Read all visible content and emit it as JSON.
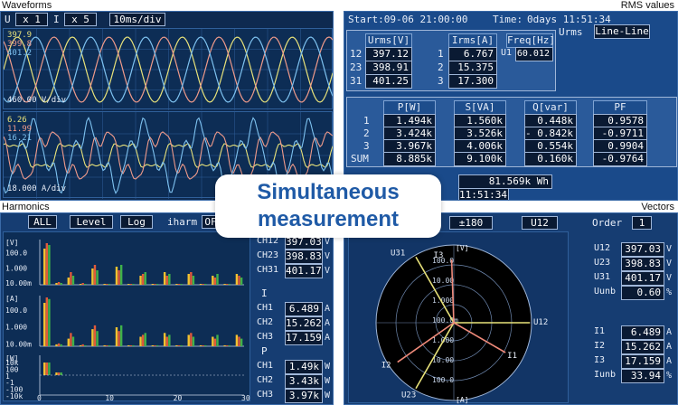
{
  "labels": {
    "waveforms": "Waveforms",
    "rms": "RMS values",
    "harmonics": "Harmonics",
    "vectors": "Vectors"
  },
  "waveforms": {
    "u_label": "U",
    "u_val": "x 1",
    "i_label": "I",
    "i_val": "x 5",
    "timebase": "10ms/div",
    "v_readings": [
      "397.9",
      "399.8",
      "401.2"
    ],
    "v_scale": "460.00 V/div",
    "a_readings": [
      "6.26",
      "11.99",
      "16.21"
    ],
    "a_scale": "18.000 A/div",
    "colors": {
      "u12": "#e8e27a",
      "u23": "#ef9a8a",
      "u31": "#7ec2f0"
    }
  },
  "rms": {
    "start": "Start:09-06 21:00:00",
    "time_label": "Time:",
    "time_val": "0days 11:51:34",
    "mode_label": "Urms",
    "mode_val": "Line-Line",
    "urms_hdr": "Urms[V]",
    "irms_hdr": "Irms[A]",
    "freq_hdr": "Freq[Hz]",
    "u_rows": [
      {
        "n": "12",
        "v": "397.12"
      },
      {
        "n": "23",
        "v": "398.91"
      },
      {
        "n": "31",
        "v": "401.25"
      }
    ],
    "i_rows": [
      {
        "n": "1",
        "v": "6.767"
      },
      {
        "n": "2",
        "v": "15.375"
      },
      {
        "n": "3",
        "v": "17.300"
      }
    ],
    "freq_row": {
      "n": "U1",
      "v": "60.012"
    },
    "p_hdr": "P[W]",
    "s_hdr": "S[VA]",
    "q_hdr": "Q[var]",
    "pf_hdr": "PF",
    "power_rows": [
      {
        "n": "1",
        "p": "1.494k",
        "s": "1.560k",
        "q": "0.448k",
        "pf": "0.9578"
      },
      {
        "n": "2",
        "p": "3.424k",
        "s": "3.526k",
        "q": "- 0.842k",
        "pf": "-0.9711"
      },
      {
        "n": "3",
        "p": "3.967k",
        "s": "4.006k",
        "q": "0.554k",
        "pf": "0.9904"
      },
      {
        "n": "SUM",
        "p": "8.885k",
        "s": "9.100k",
        "q": "0.160k",
        "pf": "-0.9764"
      }
    ],
    "energy_val": "81.569k",
    "energy_unit": "Wh",
    "elapsed": "11:51:34"
  },
  "harmonics": {
    "btn_all": "ALL",
    "btn_level": "Level",
    "btn_log": "Log",
    "mode_label": "iharm",
    "mode_val": "OF",
    "v_axis": [
      "[V]",
      "100.0",
      "1.000",
      "10.00m"
    ],
    "a_axis": [
      "[A]",
      "100.0",
      "1.000",
      "10.00m"
    ],
    "w_axis": [
      "[W]",
      "10k",
      "100",
      "1",
      "-1",
      "-100",
      "-10k"
    ],
    "x_ticks": [
      "0",
      "10",
      "20",
      "30"
    ],
    "v_group": {
      "rows": [
        {
          "n": "CH12",
          "v": "397.03",
          "u": "V"
        },
        {
          "n": "CH23",
          "v": "398.83",
          "u": "V"
        },
        {
          "n": "CH31",
          "v": "401.17",
          "u": "V"
        }
      ]
    },
    "i_group": {
      "title": "I",
      "rows": [
        {
          "n": "CH1",
          "v": "6.489",
          "u": "A"
        },
        {
          "n": "CH2",
          "v": "15.262",
          "u": "A"
        },
        {
          "n": "CH3",
          "v": "17.159",
          "u": "A"
        }
      ]
    },
    "p_group": {
      "title": "P",
      "rows": [
        {
          "n": "CH1",
          "v": "1.49k",
          "u": "W"
        },
        {
          "n": "CH2",
          "v": "3.43k",
          "u": "W"
        },
        {
          "n": "CH3",
          "v": "3.97k",
          "u": "W"
        }
      ]
    }
  },
  "vectors": {
    "range": "±180",
    "ref": "U12",
    "order_label": "Order",
    "order_val": "1",
    "v_axis_label": "[V]",
    "a_axis_label": "[A]",
    "rings": [
      "100.0",
      "10.00",
      "1.000",
      "100.0m",
      "1.000",
      "10.00",
      "100.0"
    ],
    "vector_labels": {
      "u31": "U31",
      "i3": "I3",
      "u12": "U12",
      "i1": "I1",
      "i2": "I2",
      "u23": "U23"
    },
    "u_rows": [
      {
        "n": "U12",
        "v": "397.03",
        "u": "V"
      },
      {
        "n": "U23",
        "v": "398.83",
        "u": "V"
      },
      {
        "n": "U31",
        "v": "401.17",
        "u": "V"
      },
      {
        "n": "Uunb",
        "v": "0.60",
        "u": "%"
      }
    ],
    "i_rows": [
      {
        "n": "I1",
        "v": "6.489",
        "u": "A"
      },
      {
        "n": "I2",
        "v": "15.262",
        "u": "A"
      },
      {
        "n": "I3",
        "v": "17.159",
        "u": "A"
      },
      {
        "n": "Iunb",
        "v": "33.94",
        "u": "%"
      }
    ]
  },
  "overlay": {
    "line1": "Simultaneous",
    "line2": "measurement"
  }
}
